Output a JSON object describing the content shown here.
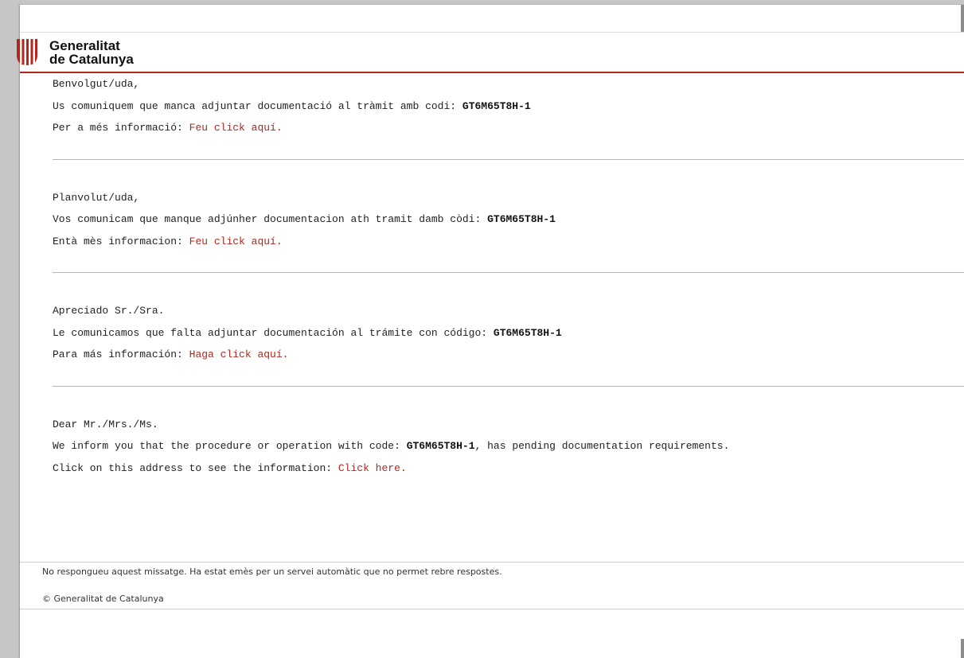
{
  "header": {
    "logo_line1": "Generalitat",
    "logo_line2": "de Catalunya",
    "brand_color": "#b3261e"
  },
  "sections": [
    {
      "greeting": "Benvolgut/uda,",
      "message_prefix": "Us comuniquem que manca adjuntar documentació al tràmit amb codi: ",
      "code": "GT6M65T8H-1",
      "message_suffix": "",
      "info_prefix": "Per a més informació: ",
      "link": "Feu click aquí."
    },
    {
      "greeting": "Planvolut/uda,",
      "message_prefix": "Vos comunicam que manque adjúnher documentacion ath tramit damb còdi: ",
      "code": "GT6M65T8H-1",
      "message_suffix": "",
      "info_prefix": "Entà mès informacion: ",
      "link": "Feu click aquí."
    },
    {
      "greeting": "Apreciado Sr./Sra.",
      "message_prefix": "Le comunicamos que falta adjuntar documentación al trámite con código: ",
      "code": "GT6M65T8H-1",
      "message_suffix": "",
      "info_prefix": "Para más información: ",
      "link": "Haga click aquí."
    },
    {
      "greeting": "Dear Mr./Mrs./Ms.",
      "message_prefix": "We inform you that the procedure or operation with code: ",
      "code": "GT6M65T8H-1",
      "message_suffix": ", has pending documentation requirements.",
      "info_prefix": "Click on this address to see the information: ",
      "link": "Click here."
    }
  ],
  "footer": {
    "notice": "No respongueu aquest missatge. Ha estat emès per un servei automàtic que no permet rebre respostes.",
    "copyright": "© Generalitat de Catalunya"
  },
  "icons": {
    "logo": "generalitat-logo-icon"
  }
}
